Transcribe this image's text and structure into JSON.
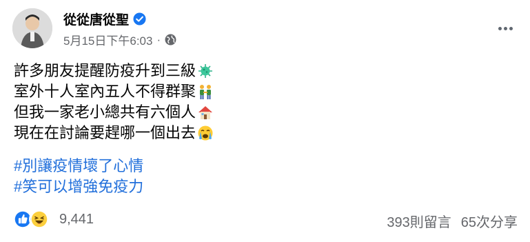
{
  "author": {
    "name": "從從唐從聖"
  },
  "post": {
    "timestamp": "5月15日下午6:03",
    "separator": "·",
    "privacy_icon": "globe-icon",
    "lines": [
      {
        "text": "許多朋友提醒防疫升到三級",
        "emoji": "virus-icon"
      },
      {
        "text": "室外十人室內五人不得群聚",
        "emoji": "people-holding-hands-icon"
      },
      {
        "text": "但我一家老小總共有六個人",
        "emoji": "house-icon"
      },
      {
        "text": "現在在討論要趕哪一個出去",
        "emoji": "crying-face-icon"
      }
    ],
    "hashtags": [
      "#別讓疫情壞了心情",
      "#笑可以增強免疫力"
    ]
  },
  "footer": {
    "reaction_icons": [
      "like-icon",
      "haha-icon"
    ],
    "reaction_count": "9,441",
    "comments": "393則留言",
    "shares": "65次分享"
  },
  "colors": {
    "link": "#216fdb",
    "secondary": "#65676b",
    "verified": "#1877f2"
  }
}
